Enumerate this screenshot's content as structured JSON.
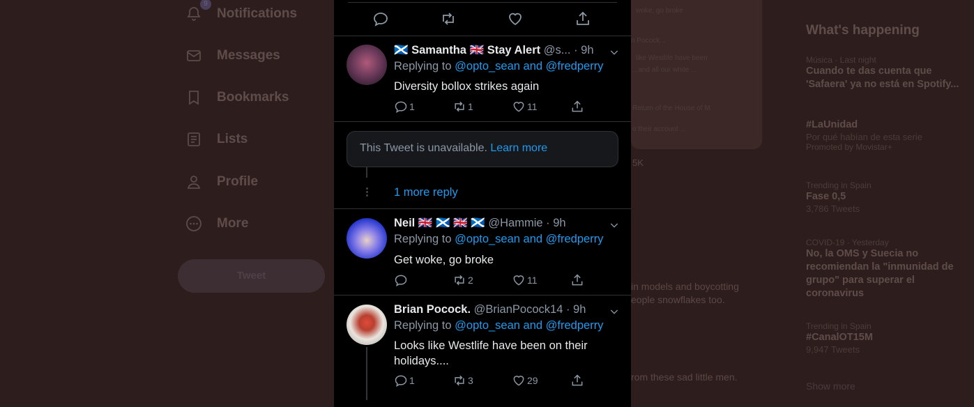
{
  "nav": {
    "badge": "9",
    "items": [
      {
        "label": "Notifications",
        "icon": "bell-icon"
      },
      {
        "label": "Messages",
        "icon": "envelope-icon"
      },
      {
        "label": "Bookmarks",
        "icon": "bookmark-icon"
      },
      {
        "label": "Lists",
        "icon": "list-icon"
      },
      {
        "label": "Profile",
        "icon": "person-icon"
      },
      {
        "label": "More",
        "icon": "more-circle-icon"
      }
    ],
    "tweet_button": "Tweet"
  },
  "background_text": {
    "line1": "woke, go broke",
    "line2": "n Pocock...",
    "line3": "like Westlife have been",
    "line4": "...and all our white ...",
    "line5": "Return of the House of M",
    "line6": "o their account ...",
    "stat": "5K",
    "line7": "in models and boycotting",
    "line8": "eople snowflakes too.",
    "line9": "rom these sad little men."
  },
  "right": {
    "heading": "What's happening",
    "trends": [
      {
        "meta": "Música · Last night",
        "title": "Cuando te das cuenta que 'Safaera' ya no está en Spotify...",
        "sub": ""
      },
      {
        "meta": "",
        "title": "#LaUnidad",
        "sub": "Por qué habían de esta serie",
        "promo": "Promoted by Movistar+"
      },
      {
        "meta": "Trending in Spain",
        "title": "Fase 0,5",
        "sub": "3,786 Tweets"
      },
      {
        "meta": "COVID-19 · Yesterday",
        "title": "No, la OMS y Suecia no recomiendan la \"inmunidad de grupo\" para superar el coronavirus",
        "sub": ""
      },
      {
        "meta": "Trending in Spain",
        "title": "#CanalOT15M",
        "sub": "9,947 Tweets"
      }
    ],
    "show_more": "Show more"
  },
  "tweets": [
    {
      "name": "🏴󠁧󠁢󠁳󠁣󠁴󠁿 Samantha 🇬🇧 Stay Alert",
      "handle": "@s...",
      "time": "· 9h",
      "replying_prefix": "Replying to ",
      "replying_to": "@opto_sean and @fredperry",
      "text": "Diversity bollox strikes again",
      "replies": "1",
      "retweets": "1",
      "likes": "11",
      "avatar_color": "#6b3a5a"
    },
    {
      "name": "Neil 🇬🇧 🏴󠁧󠁢󠁳󠁣󠁴󠁿 🇬🇧 🏴󠁧󠁢󠁳󠁣󠁴󠁿",
      "handle": "@Hammie",
      "time": "· 9h",
      "replying_prefix": "Replying to ",
      "replying_to": "@opto_sean and @fredperry",
      "text": "Get woke, go broke",
      "replies": "",
      "retweets": "2",
      "likes": "11",
      "avatar_color": "#3a4fd0"
    },
    {
      "name": "Brian Pocock.",
      "handle": "@BrianPocock14",
      "time": "· 9h",
      "replying_prefix": "Replying to ",
      "replying_to": "@opto_sean and @fredperry",
      "text": "Looks like Westlife have been on their holidays....",
      "replies": "1",
      "retweets": "3",
      "likes": "29",
      "avatar_color": "#c9c2b8"
    }
  ],
  "unavailable": {
    "text": "This Tweet is unavailable. ",
    "link": "Learn more"
  },
  "more_reply": "1 more reply"
}
